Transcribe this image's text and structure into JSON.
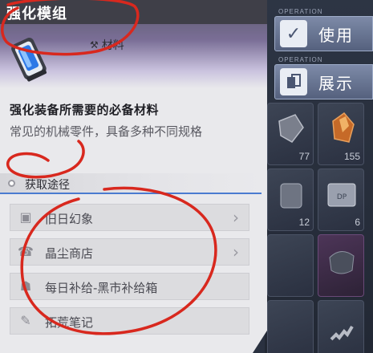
{
  "panel": {
    "title": "强化模组",
    "category": "材料",
    "category_icon": "hammer-icon",
    "item_name": "强化装备所需要的必备材料",
    "item_desc": "常见的机械零件，具备多种不同规格"
  },
  "source": {
    "header": "获取途径",
    "items": [
      {
        "label": "旧日幻象",
        "icon": "building-icon",
        "has_arrow": true
      },
      {
        "label": "晶尘商店",
        "icon": "shop-icon",
        "has_arrow": true
      },
      {
        "label": "每日补给-黑市补给箱",
        "icon": "supply-icon",
        "has_arrow": false
      },
      {
        "label": "拓荒笔记",
        "icon": "notes-icon",
        "has_arrow": false
      }
    ]
  },
  "operations": [
    {
      "tag": "OPERATION",
      "label": "使用",
      "icon": "check-icon"
    },
    {
      "tag": "OPERATION",
      "label": "展示",
      "icon": "cards-icon"
    }
  ],
  "inventory": {
    "counts": [
      "77",
      "155",
      "12",
      "6"
    ]
  },
  "colors": {
    "annotation": "#d8281e",
    "accent": "#4a7bd0",
    "panel_bg": "#e9e9ec"
  }
}
